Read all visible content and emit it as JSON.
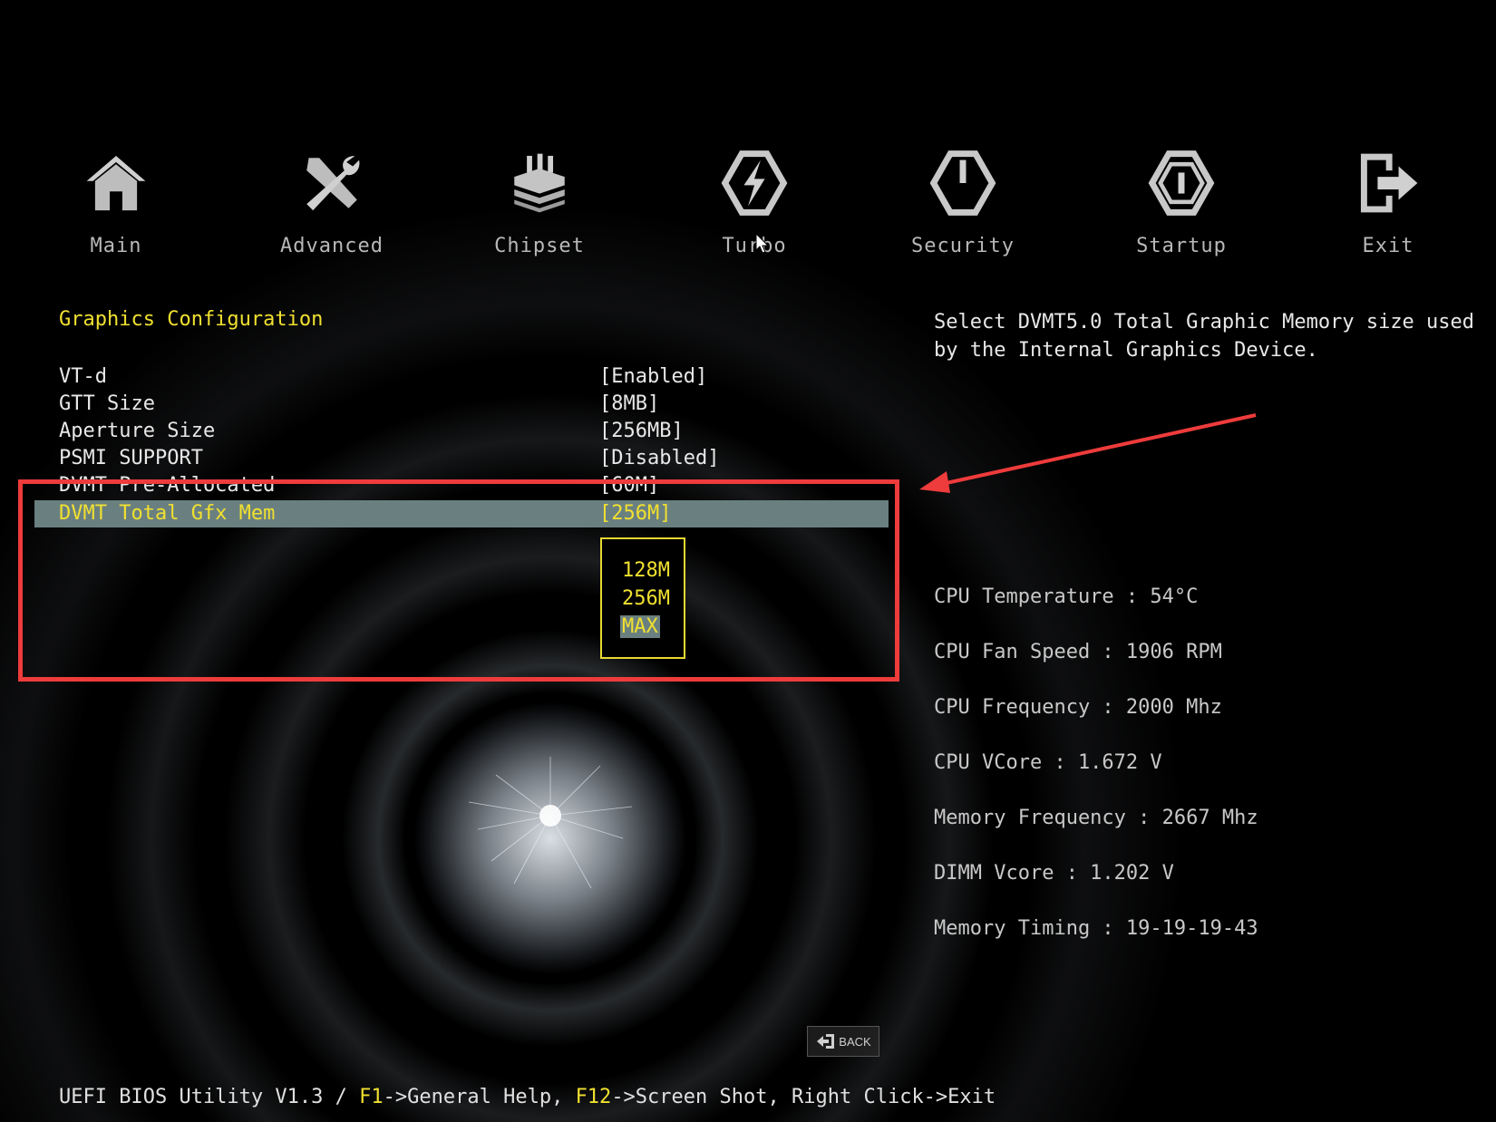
{
  "nav": {
    "items": [
      {
        "label": "Main",
        "icon": "home-icon"
      },
      {
        "label": "Advanced",
        "icon": "tools-icon"
      },
      {
        "label": "Chipset",
        "icon": "chip-icon"
      },
      {
        "label": "Turbo",
        "icon": "lightning-icon"
      },
      {
        "label": "Security",
        "icon": "power-icon"
      },
      {
        "label": "Startup",
        "icon": "startup-icon"
      },
      {
        "label": "Exit",
        "icon": "exit-icon"
      }
    ]
  },
  "section": {
    "title": "Graphics Configuration"
  },
  "settings": [
    {
      "name": "VT-d",
      "value": "[Enabled]"
    },
    {
      "name": "GTT Size",
      "value": "[8MB]"
    },
    {
      "name": "Aperture Size",
      "value": "[256MB]"
    },
    {
      "name": "PSMI SUPPORT",
      "value": "[Disabled]"
    },
    {
      "name": "DVMT Pre-Allocated",
      "value": "[60M]"
    },
    {
      "name": "DVMT Total Gfx Mem",
      "value": "[256M]"
    }
  ],
  "dropdown": {
    "options": [
      "128M",
      "256M",
      "MAX"
    ],
    "highlighted": "MAX"
  },
  "help": {
    "text": "Select DVMT5.0 Total Graphic Memory size used by the Internal Graphics Device."
  },
  "status": {
    "cpu_temperature": "CPU Temperature : 54°C",
    "cpu_fan_speed": "CPU Fan Speed : 1906 RPM",
    "cpu_frequency": "CPU Frequency : 2000 Mhz",
    "cpu_vcore": "CPU VCore : 1.672 V",
    "memory_frequency": "Memory Frequency : 2667 Mhz",
    "dimm_vcore": "DIMM Vcore : 1.202 V",
    "memory_timing": "Memory Timing : 19-19-19-43"
  },
  "back_button": {
    "label": "BACK"
  },
  "footer": {
    "prefix": "UEFI BIOS Utility V1.3 / ",
    "key1": "F1",
    "text1": "->General Help, ",
    "key2": "F12",
    "text2": "->Screen Shot, Right Click->Exit"
  },
  "colors": {
    "accent_yellow": "#f0e030",
    "selection_bg": "#6a8080",
    "annotation_red": "#ee3b3b"
  }
}
